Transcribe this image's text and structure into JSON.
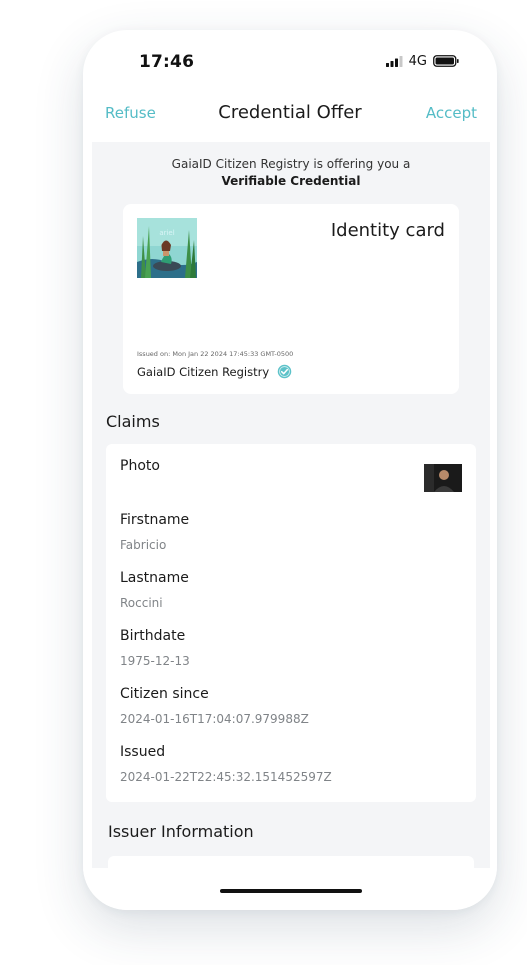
{
  "status_bar": {
    "time": "17:46",
    "network": "4G",
    "icons": [
      "signal-icon",
      "battery-icon"
    ]
  },
  "nav": {
    "refuse_label": "Refuse",
    "title": "Credential Offer",
    "accept_label": "Accept",
    "accent_color": "#54bcc6"
  },
  "offer": {
    "intro": "GaiaID Citizen Registry is offering you a",
    "credential_type": "Verifiable Credential"
  },
  "credential_card": {
    "title": "Identity card",
    "issued_on": "Issued on: Mon Jan 22 2024 17:45:33 GMT-0500",
    "issuer_name": "GaiaID Citizen Registry",
    "verified_icon": "verified-check-icon"
  },
  "claims": {
    "heading": "Claims",
    "items": [
      {
        "label": "Photo",
        "value": ""
      },
      {
        "label": "Firstname",
        "value": "Fabricio"
      },
      {
        "label": "Lastname",
        "value": "Roccini"
      },
      {
        "label": "Birthdate",
        "value": "1975-12-13"
      },
      {
        "label": "Citizen since",
        "value": "2024-01-16T17:04:07.979988Z"
      },
      {
        "label": "Issued",
        "value": "2024-01-22T22:45:32.151452597Z"
      }
    ]
  },
  "issuer_info": {
    "heading": "Issuer Information"
  }
}
